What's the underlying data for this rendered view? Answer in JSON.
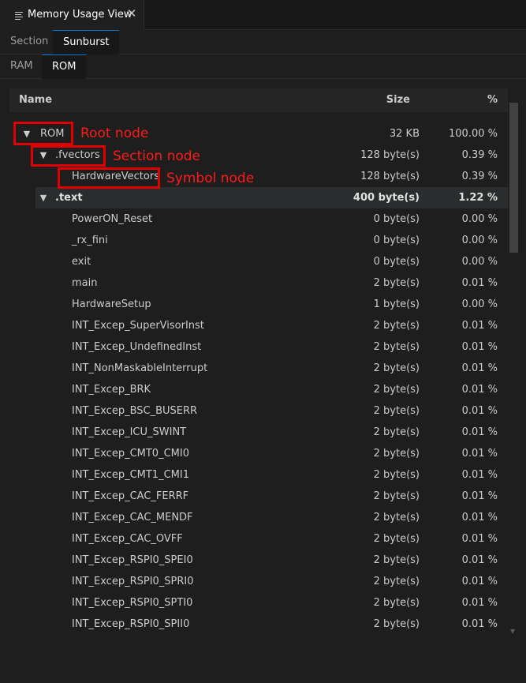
{
  "window": {
    "tab_title": "Memory Usage View"
  },
  "view_tabs": [
    {
      "label": "Section",
      "active": false
    },
    {
      "label": "Sunburst",
      "active": true
    }
  ],
  "sub_tabs": [
    {
      "label": "RAM",
      "active": false
    },
    {
      "label": "ROM",
      "active": true
    }
  ],
  "table": {
    "headers": {
      "name": "Name",
      "size": "Size",
      "percent": "%"
    },
    "rows": [
      {
        "name": "ROM",
        "size": "32 KB",
        "percent": "100.00 %",
        "level": 0,
        "expanded": true,
        "selected": false
      },
      {
        "name": ".fvectors",
        "size": "128 byte(s)",
        "percent": "0.39 %",
        "level": 1,
        "expanded": true,
        "selected": false
      },
      {
        "name": "HardwareVectors",
        "size": "128 byte(s)",
        "percent": "0.39 %",
        "level": 2,
        "expanded": null,
        "selected": false
      },
      {
        "name": ".text",
        "size": "400 byte(s)",
        "percent": "1.22 %",
        "level": 1,
        "expanded": true,
        "selected": true
      },
      {
        "name": "PowerON_Reset",
        "size": "0 byte(s)",
        "percent": "0.00 %",
        "level": 2,
        "expanded": null,
        "selected": false
      },
      {
        "name": "_rx_fini",
        "size": "0 byte(s)",
        "percent": "0.00 %",
        "level": 2,
        "expanded": null,
        "selected": false
      },
      {
        "name": "exit",
        "size": "0 byte(s)",
        "percent": "0.00 %",
        "level": 2,
        "expanded": null,
        "selected": false
      },
      {
        "name": "main",
        "size": "2 byte(s)",
        "percent": "0.01 %",
        "level": 2,
        "expanded": null,
        "selected": false
      },
      {
        "name": "HardwareSetup",
        "size": "1 byte(s)",
        "percent": "0.00 %",
        "level": 2,
        "expanded": null,
        "selected": false
      },
      {
        "name": "INT_Excep_SuperVisorInst",
        "size": "2 byte(s)",
        "percent": "0.01 %",
        "level": 2,
        "expanded": null,
        "selected": false
      },
      {
        "name": "INT_Excep_UndefinedInst",
        "size": "2 byte(s)",
        "percent": "0.01 %",
        "level": 2,
        "expanded": null,
        "selected": false
      },
      {
        "name": "INT_NonMaskableInterrupt",
        "size": "2 byte(s)",
        "percent": "0.01 %",
        "level": 2,
        "expanded": null,
        "selected": false
      },
      {
        "name": "INT_Excep_BRK",
        "size": "2 byte(s)",
        "percent": "0.01 %",
        "level": 2,
        "expanded": null,
        "selected": false
      },
      {
        "name": "INT_Excep_BSC_BUSERR",
        "size": "2 byte(s)",
        "percent": "0.01 %",
        "level": 2,
        "expanded": null,
        "selected": false
      },
      {
        "name": "INT_Excep_ICU_SWINT",
        "size": "2 byte(s)",
        "percent": "0.01 %",
        "level": 2,
        "expanded": null,
        "selected": false
      },
      {
        "name": "INT_Excep_CMT0_CMI0",
        "size": "2 byte(s)",
        "percent": "0.01 %",
        "level": 2,
        "expanded": null,
        "selected": false
      },
      {
        "name": "INT_Excep_CMT1_CMI1",
        "size": "2 byte(s)",
        "percent": "0.01 %",
        "level": 2,
        "expanded": null,
        "selected": false
      },
      {
        "name": "INT_Excep_CAC_FERRF",
        "size": "2 byte(s)",
        "percent": "0.01 %",
        "level": 2,
        "expanded": null,
        "selected": false
      },
      {
        "name": "INT_Excep_CAC_MENDF",
        "size": "2 byte(s)",
        "percent": "0.01 %",
        "level": 2,
        "expanded": null,
        "selected": false
      },
      {
        "name": "INT_Excep_CAC_OVFF",
        "size": "2 byte(s)",
        "percent": "0.01 %",
        "level": 2,
        "expanded": null,
        "selected": false
      },
      {
        "name": "INT_Excep_RSPI0_SPEI0",
        "size": "2 byte(s)",
        "percent": "0.01 %",
        "level": 2,
        "expanded": null,
        "selected": false
      },
      {
        "name": "INT_Excep_RSPI0_SPRI0",
        "size": "2 byte(s)",
        "percent": "0.01 %",
        "level": 2,
        "expanded": null,
        "selected": false
      },
      {
        "name": "INT_Excep_RSPI0_SPTI0",
        "size": "2 byte(s)",
        "percent": "0.01 %",
        "level": 2,
        "expanded": null,
        "selected": false
      },
      {
        "name": "INT_Excep_RSPI0_SPII0",
        "size": "2 byte(s)",
        "percent": "0.01 %",
        "level": 2,
        "expanded": null,
        "selected": false
      }
    ]
  },
  "annotations": [
    {
      "label": "Root node"
    },
    {
      "label": "Section node"
    },
    {
      "label": "Symbol node"
    }
  ],
  "colors": {
    "annotation": "#e00000",
    "accent": "#0078d4",
    "selected_row": "#2a2d2e"
  }
}
